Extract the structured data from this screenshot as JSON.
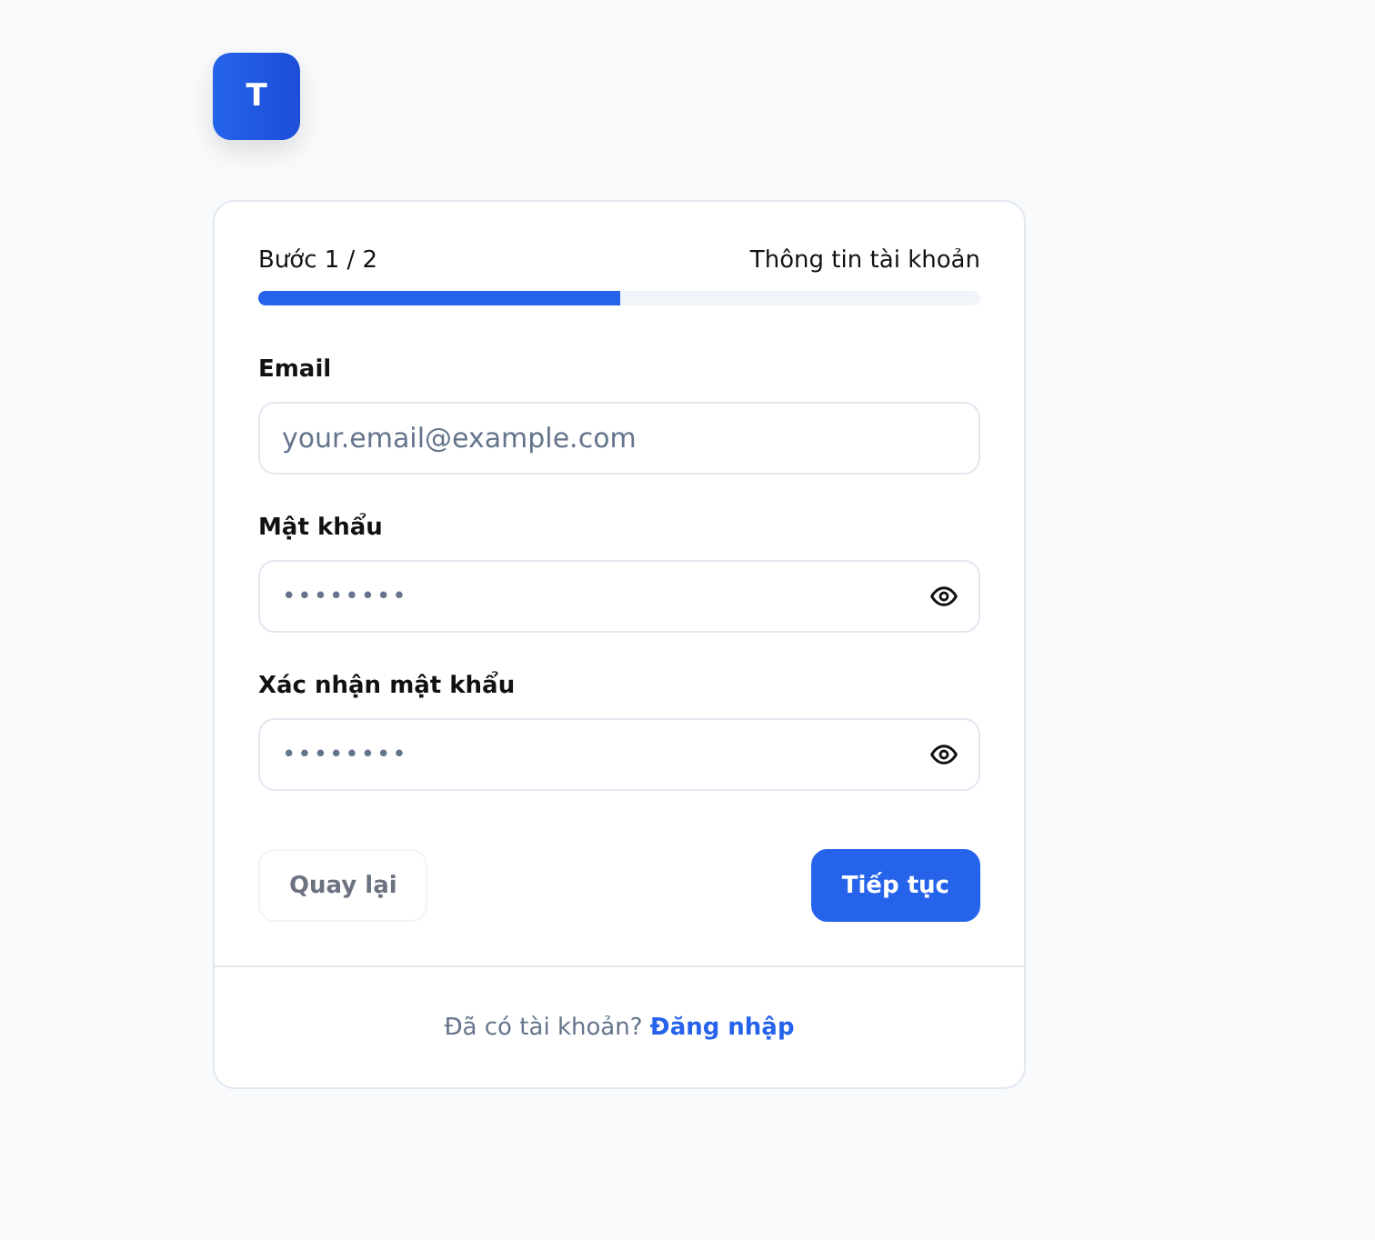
{
  "logo": {
    "letter": "T"
  },
  "progress": {
    "step": "Bước 1 / 2",
    "title": "Thông tin tài khoản",
    "level": 0.5
  },
  "fields": [
    {
      "label": "Email",
      "kind": "text",
      "placeholder": "your.email@example.com"
    },
    {
      "label": "Mật khẩu",
      "kind": "password",
      "value": "••••••••"
    },
    {
      "label": "Xác nhận mật khẩu",
      "kind": "password",
      "value": "••••••••"
    }
  ],
  "buttons": {
    "back": {
      "label": "Quay lại",
      "disabled": true
    },
    "next": {
      "label": "Tiếp tục",
      "disabled": false
    }
  },
  "footer": {
    "text": "Đã có tài khoản?",
    "link": "Đăng nhập"
  }
}
